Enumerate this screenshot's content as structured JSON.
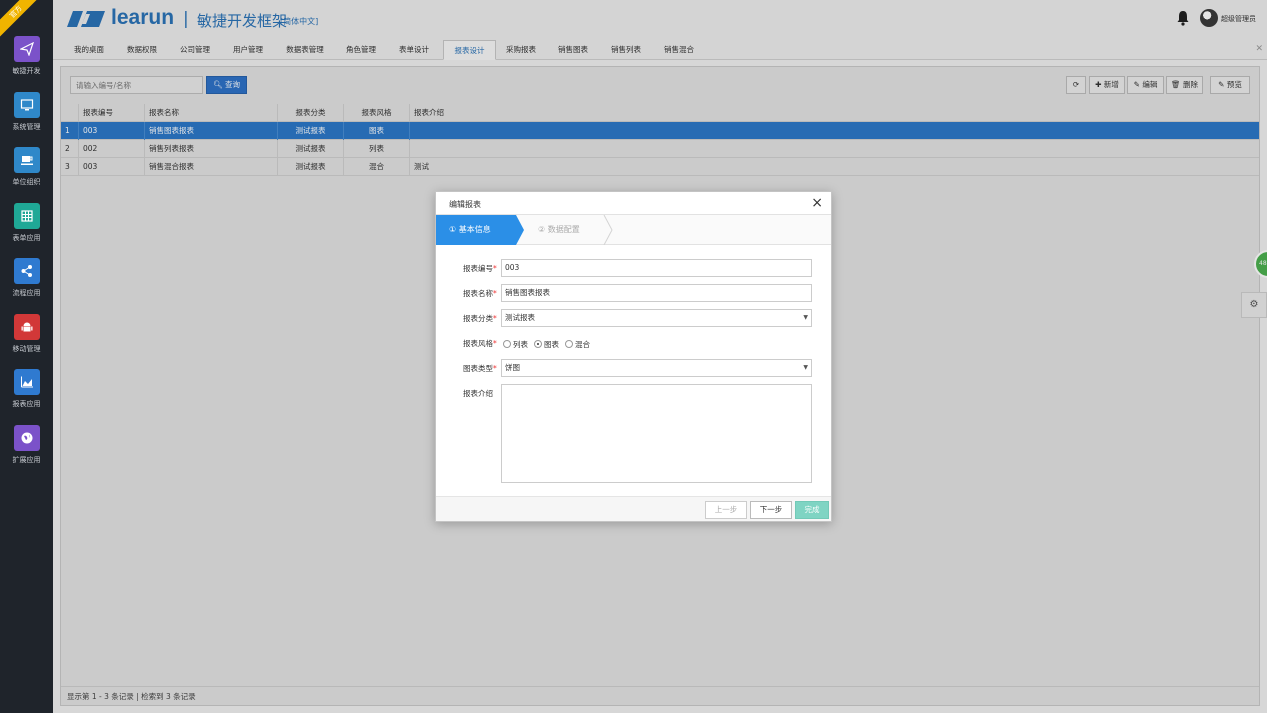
{
  "badge": "官方",
  "sidebar": {
    "items": [
      {
        "label": "敏捷开发",
        "icon": "paper-plane-icon",
        "color": "#7b52c9"
      },
      {
        "label": "系统管理",
        "icon": "monitor-icon",
        "color": "#2f88c9"
      },
      {
        "label": "单位组织",
        "icon": "coffee-icon",
        "color": "#2f88c9"
      },
      {
        "label": "表单应用",
        "icon": "table-icon",
        "color": "#1fa896"
      },
      {
        "label": "流程应用",
        "icon": "share-icon",
        "color": "#2f7ad0"
      },
      {
        "label": "移动管理",
        "icon": "android-icon",
        "color": "#d23838"
      },
      {
        "label": "报表应用",
        "icon": "area-chart-icon",
        "color": "#2f7ad0"
      },
      {
        "label": "扩展应用",
        "icon": "globe-icon",
        "color": "#7b52c9"
      }
    ]
  },
  "header": {
    "logo_text": "learun",
    "separator": "|",
    "subtitle": "敏捷开发框架",
    "lang": "[简体中文]",
    "user": "超级管理员"
  },
  "tabs": [
    "我的桌面",
    "数据权限",
    "公司管理",
    "用户管理",
    "数据表管理",
    "角色管理",
    "表单设计",
    "报表设计",
    "采购报表",
    "销售图表",
    "销售列表",
    "销售混合"
  ],
  "active_tab": "报表设计",
  "toolbar": {
    "search_placeholder": "请输入编号/名称",
    "search_label": "查询",
    "refresh_label": "",
    "add_label": "新增",
    "edit_label": "编辑",
    "delete_label": "删除",
    "preview_label": "预览"
  },
  "table": {
    "headers": [
      "报表编号",
      "报表名称",
      "报表分类",
      "报表风格",
      "报表介绍"
    ],
    "rows": [
      {
        "n": "1",
        "code": "003",
        "name": "销售图表报表",
        "category": "测试报表",
        "style": "图表",
        "desc": ""
      },
      {
        "n": "2",
        "code": "002",
        "name": "销售列表报表",
        "category": "测试报表",
        "style": "列表",
        "desc": ""
      },
      {
        "n": "3",
        "code": "003",
        "name": "销售混合报表",
        "category": "测试报表",
        "style": "混合",
        "desc": "测试"
      }
    ],
    "status": "显示第 1 - 3 条记录 | 检索到 3 条记录"
  },
  "modal": {
    "title": "编辑报表",
    "step1": "① 基本信息",
    "step2": "② 数据配置",
    "fields": {
      "code_label": "报表编号",
      "code_value": "003",
      "name_label": "报表名称",
      "name_value": "销售图表报表",
      "category_label": "报表分类",
      "category_value": "测试报表",
      "style_label": "报表风格",
      "style_options": [
        "列表",
        "图表",
        "混合"
      ],
      "style_selected": "图表",
      "chart_type_label": "图表类型",
      "chart_type_value": "饼图",
      "desc_label": "报表介绍",
      "desc_value": ""
    },
    "required_mark": "*",
    "prev_label": "上一步",
    "next_label": "下一步",
    "done_label": "完成"
  },
  "float_badge": "48"
}
